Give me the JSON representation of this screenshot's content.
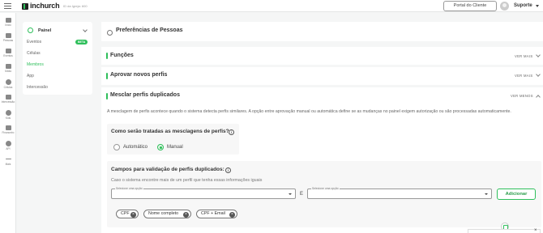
{
  "app": {
    "logo": "inchurch",
    "church_id": "ID da Igreja: 600"
  },
  "header": {
    "portal_button": "Portal do Cliente",
    "user_name": "Suporte"
  },
  "rail": [
    {
      "label": "Início",
      "icon": "home-icon"
    },
    {
      "label": "Pessoas",
      "icon": "people-icon"
    },
    {
      "label": "Eventos",
      "icon": "calendar-icon"
    },
    {
      "label": "Mídia",
      "icon": "media-icon"
    },
    {
      "label": "Células",
      "icon": "cells-icon"
    },
    {
      "label": "Intercessão",
      "icon": "intercession-icon"
    },
    {
      "label": "Kids",
      "icon": "kids-icon"
    },
    {
      "label": "Financeiro",
      "icon": "finance-icon"
    },
    {
      "label": "API",
      "icon": "api-icon"
    },
    {
      "label": "Mais",
      "icon": "more-icon"
    }
  ],
  "submenu": {
    "title": "Painel",
    "items": [
      {
        "label": "Eventos",
        "badge": "BETA",
        "active": false
      },
      {
        "label": "Células",
        "active": false
      },
      {
        "label": "Membros",
        "active": true
      },
      {
        "label": "App",
        "active": false
      },
      {
        "label": "Intercessão",
        "active": false
      }
    ]
  },
  "page": {
    "title": "Preferências de Pessoas",
    "sections": [
      {
        "title": "Funções",
        "toggle": "VER MAIS"
      },
      {
        "title": "Aprovar novos perfis",
        "toggle": "VER MAIS"
      },
      {
        "title": "Mesclar perfis duplicados",
        "toggle": "VER MENOS"
      }
    ],
    "mesclar": {
      "description": "A mesclagem de perfis acontece quando o sistema detecta perfis similares. A opção entre aprovação manual ou automática define se as mudanças no painel exigem autorização ou são processadas automaticamente.",
      "question": "Como serão tratadas as mesclagens de perfis?",
      "options": [
        {
          "label": "Automático",
          "selected": false
        },
        {
          "label": "Manual",
          "selected": true
        }
      ],
      "fields_title": "Campos para validação de perfis duplicados:",
      "fields_subtitle": "Caso o sistema encontre mais de um perfil que tenha essas informações iguais",
      "select_placeholder": "Selecione uma opção",
      "and_label": "E",
      "add_button": "Adicionar",
      "chips": [
        "CPF",
        "Nome completo",
        "CPF + Email"
      ]
    }
  },
  "colors": {
    "accent": "#2fbf5b"
  }
}
